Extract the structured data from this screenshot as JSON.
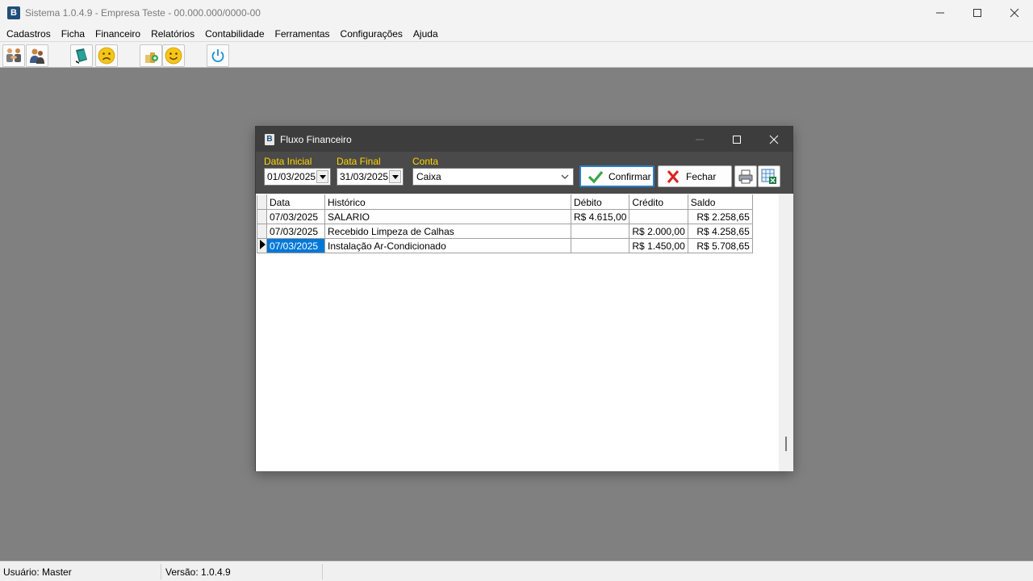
{
  "window": {
    "title": "Sistema 1.0.4.9 - Empresa Teste - 00.000.000/0000-00",
    "app_icon_glyph": "B"
  },
  "menu": {
    "items": [
      "Cadastros",
      "Ficha",
      "Financeiro",
      "Relatórios",
      "Contabilidade",
      "Ferramentas",
      "Configurações",
      "Ajuda"
    ]
  },
  "toolbar": {
    "buttons": [
      "handshake-icon",
      "users-icon",
      "book-icon",
      "sad-face-icon",
      "money-plant-icon",
      "smiley-icon",
      "power-icon"
    ]
  },
  "child": {
    "title": "Fluxo Financeiro",
    "filters": {
      "data_inicial_label": "Data Inicial",
      "data_inicial_value": "01/03/2025",
      "data_final_label": "Data Final",
      "data_final_value": "31/03/2025",
      "conta_label": "Conta",
      "conta_value": "Caixa"
    },
    "buttons": {
      "confirmar": "Confirmar",
      "fechar": "Fechar"
    },
    "grid": {
      "columns": [
        "Data",
        "Histórico",
        "Débito",
        "Crédito",
        "Saldo"
      ],
      "rows": [
        {
          "data": "07/03/2025",
          "historico": "SALARIO",
          "debito": "R$ 4.615,00",
          "credito": "",
          "saldo": "R$ 2.258,65"
        },
        {
          "data": "07/03/2025",
          "historico": "Recebido Limpeza de Calhas",
          "debito": "",
          "credito": "R$ 2.000,00",
          "saldo": "R$ 4.258,65"
        },
        {
          "data": "07/03/2025",
          "historico": "Instalação Ar-Condicionado",
          "debito": "",
          "credito": "R$ 1.450,00",
          "saldo": "R$ 5.708,65"
        }
      ]
    }
  },
  "status": {
    "usuario": "Usuário: Master",
    "versao": "Versão: 1.0.4.9"
  },
  "colors": {
    "label_yellow": "#ffd400",
    "selection_blue": "#0078d7",
    "child_title_bg": "#3d3d3d"
  }
}
